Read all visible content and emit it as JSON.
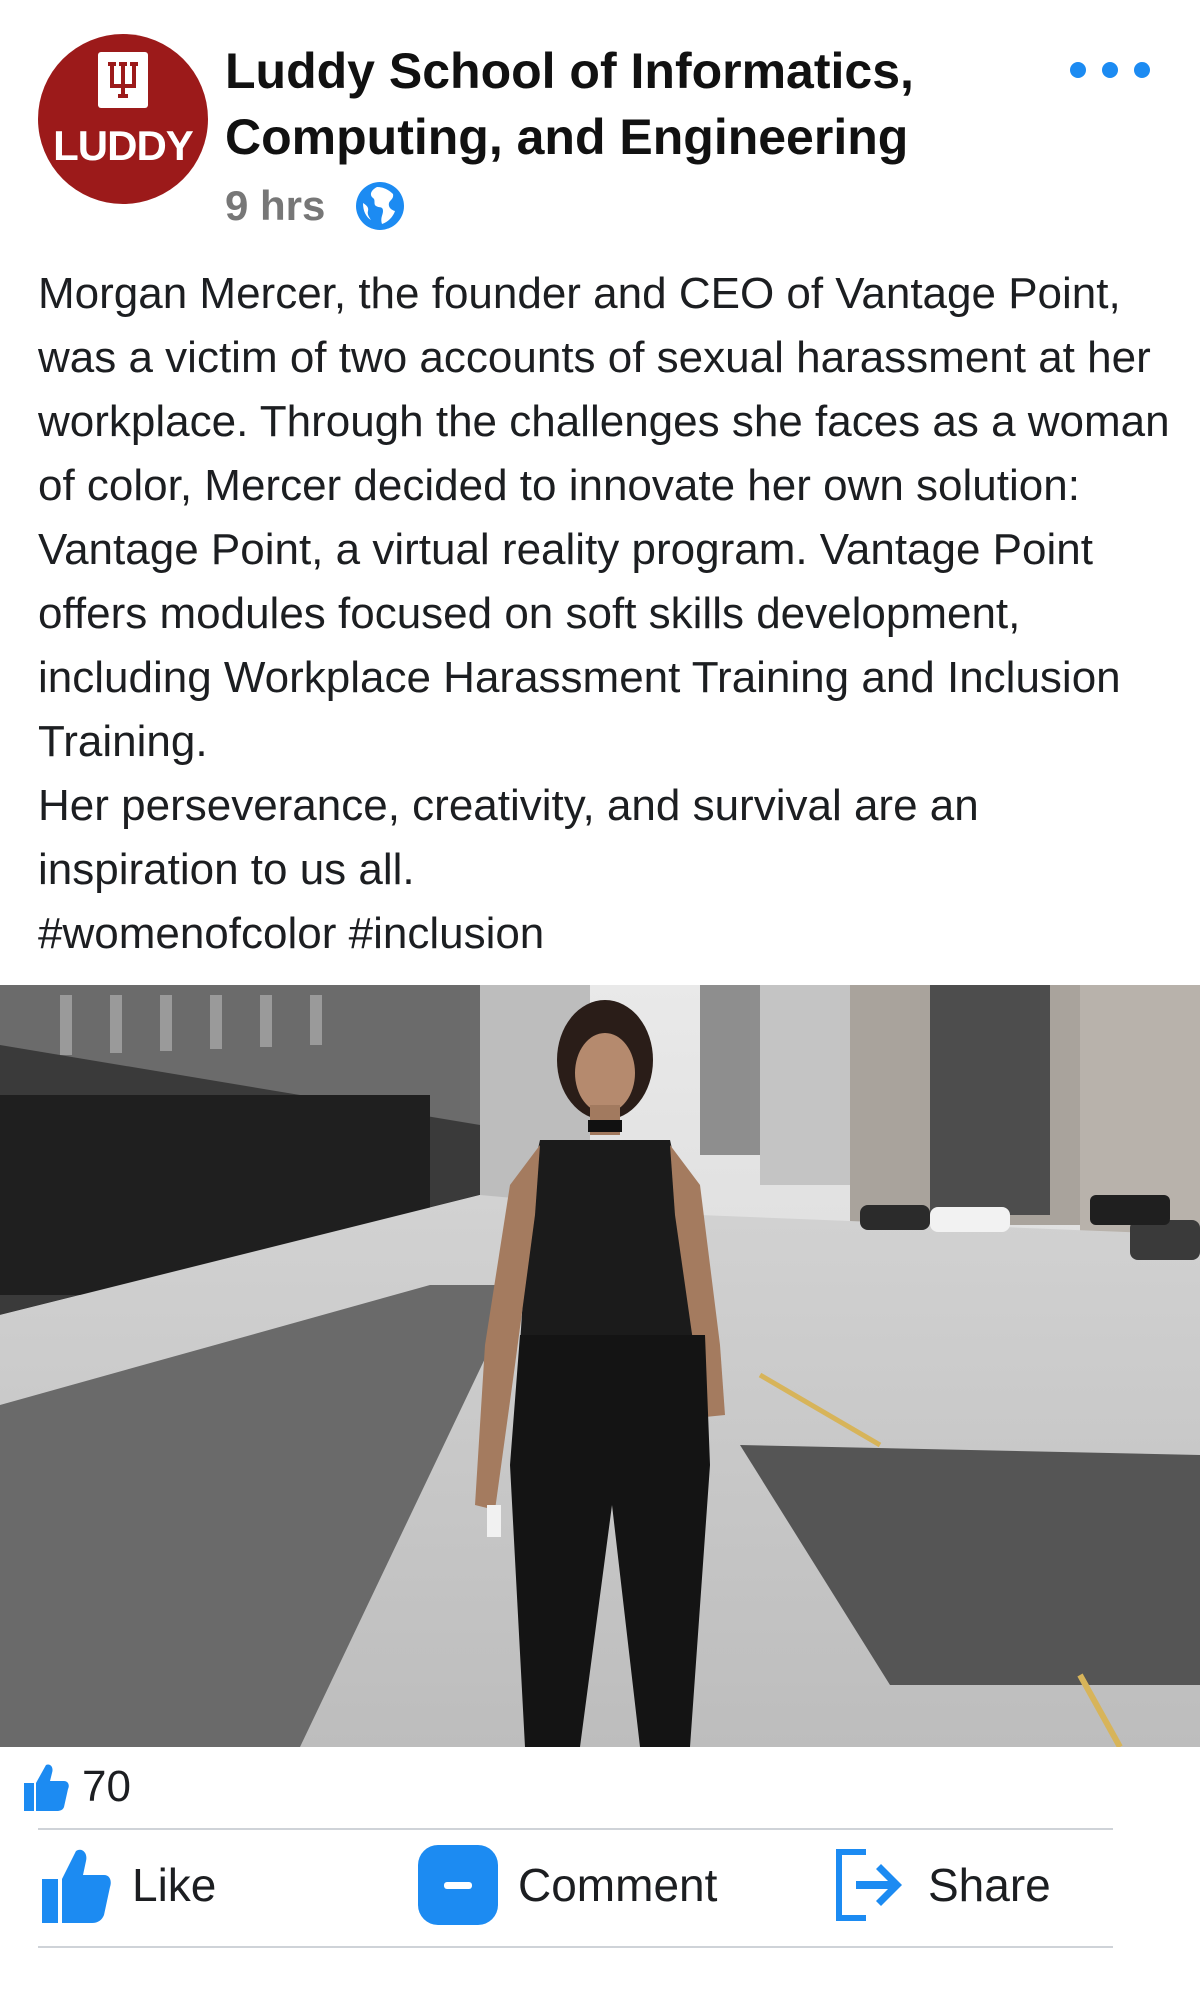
{
  "page": {
    "author": "Luddy School of Informatics, Computing, and Engineering",
    "avatar_text": "LUDDY",
    "timestamp": "9 hrs",
    "privacy_icon": "globe-icon",
    "more_icon": "more-dots-icon"
  },
  "post": {
    "paragraphs": [
      "Morgan Mercer, the founder and CEO of Vantage Point, was a victim of two accounts of sexual harassment at her workplace. Through the challenges she faces as a woman of color, Mercer decided to innovate her own solution: Vantage Point, a virtual reality program. Vantage Point offers modules focused on soft skills development, including Workplace Harassment Training and Inclusion Training.",
      "Her perseverance, creativity, and survival are an inspiration to us all.",
      "#womenofcolor #inclusion"
    ]
  },
  "reactions": {
    "count": "70",
    "icon": "thumbs-up-icon"
  },
  "actions": {
    "like": "Like",
    "comment": "Comment",
    "share": "Share"
  },
  "colors": {
    "accent": "#1c8bf2",
    "brand": "#9c1a1a",
    "text": "#1c1e21",
    "muted": "#777777"
  }
}
